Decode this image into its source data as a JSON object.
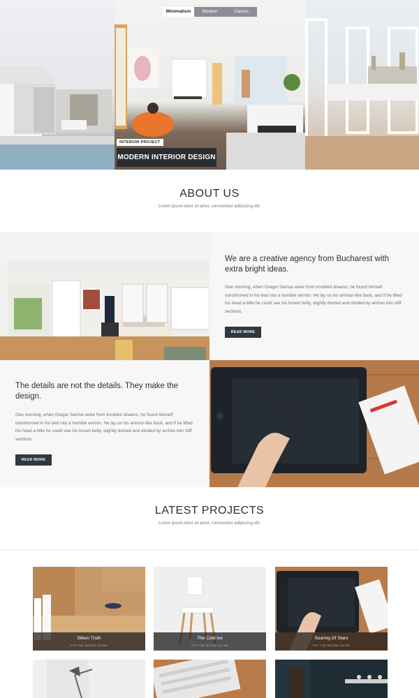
{
  "hero": {
    "style_tabs": [
      "Minimalism",
      "Modern",
      "Classic"
    ],
    "active_tab": "Minimalism",
    "caption_tag": "INTERIOR PROJECT",
    "caption_title": "MODERN INTERIOR DESIGN"
  },
  "about": {
    "title": "ABOUT US",
    "subtitle": "Lorem ipsum dolor sit amet, consectetur adipiscing elit."
  },
  "features": [
    {
      "heading": "We are a creative agency from Bucharest with extra bright ideas.",
      "body": "One morning, when Gregor Samsa woke from troubled dreams, he found himself transformed in his bed into a horrible vermin. He lay on his armour-like back, and if he lifted his head a little he could see his brown belly, slightly domed and divided by arches into stiff sections.",
      "button": "READ MORE"
    },
    {
      "heading": "The details are not the details. They make the design.",
      "body": "One morning, when Gregor Samsa woke from troubled dreams, he found himself transformed in his bed into a horrible vermin. He lay on his armour-like back, and if he lifted his head a little he could see his brown belly, slightly domed and divided by arches into stiff sections.",
      "button": "READ MORE"
    }
  ],
  "projects": {
    "title": "LATEST PROJECTS",
    "subtitle": "Lorem ipsum dolor sit amet, consectetur adipiscing elit.",
    "items": [
      {
        "title": "Silken Truth",
        "hint": "PUT THE MOUSE ON ME"
      },
      {
        "title": "The Cold Ice",
        "hint": "PUT THE MOUSE ON ME"
      },
      {
        "title": "Soaring Of Stars",
        "hint": "PUT THE MOUSE ON ME"
      }
    ]
  },
  "colors": {
    "dark_button": "#2f3741",
    "heading": "#2a2f36",
    "section_bg": "#f7f7f7"
  }
}
